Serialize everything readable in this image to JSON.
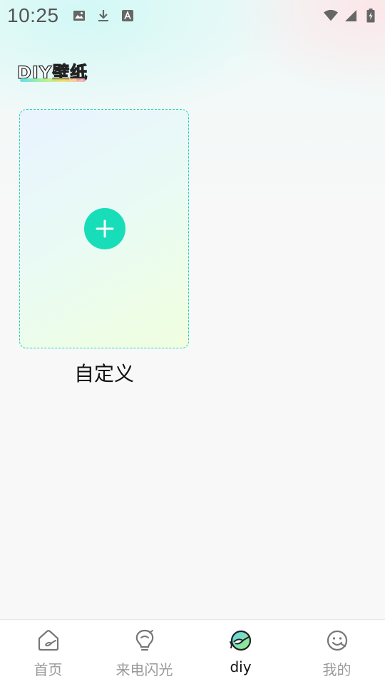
{
  "status_bar": {
    "time": "10:25",
    "left_icons": [
      "image-icon",
      "download-icon",
      "font-icon"
    ],
    "right_icons": [
      "wifi-icon",
      "signal-icon",
      "battery-icon"
    ]
  },
  "header": {
    "logo_text": "DIY壁纸"
  },
  "main": {
    "custom_card": {
      "label": "自定义",
      "border_color": "#22d3b0",
      "button_color": "#17ddb8"
    }
  },
  "bottom_nav": {
    "items": [
      {
        "label": "首页",
        "icon": "home-icon",
        "active": false
      },
      {
        "label": "来电闪光",
        "icon": "bulb-icon",
        "active": false
      },
      {
        "label": "diy",
        "icon": "diy-icon",
        "active": true
      },
      {
        "label": "我的",
        "icon": "smiley-icon",
        "active": false
      }
    ]
  }
}
